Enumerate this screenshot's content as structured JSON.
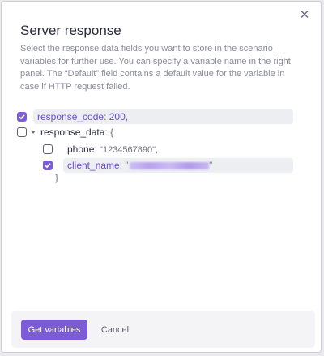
{
  "dialog": {
    "title": "Server response",
    "description": "Select the response data fields you want to store in the scenario variables for further use. You can specify a variable name in the right panel. The “Default” field contains a default value for the variable in case if HTTP request failed.",
    "close_icon": "close-icon"
  },
  "fields": {
    "response_code": {
      "key": "response_code",
      "value": "200,",
      "checked": true
    },
    "response_data": {
      "key": "response_data",
      "open": "{",
      "close": "}",
      "checked": false
    },
    "phone": {
      "key": "phone",
      "value": "\"1234567890\",",
      "checked": false
    },
    "client_name": {
      "key": "client_name",
      "value_prefix": "\"",
      "value_suffix": "\"",
      "checked": true
    }
  },
  "footer": {
    "primary_label": "Get variables",
    "cancel_label": "Cancel"
  },
  "colors": {
    "accent": "#7b5cd6",
    "field_bg": "#eceef2"
  }
}
